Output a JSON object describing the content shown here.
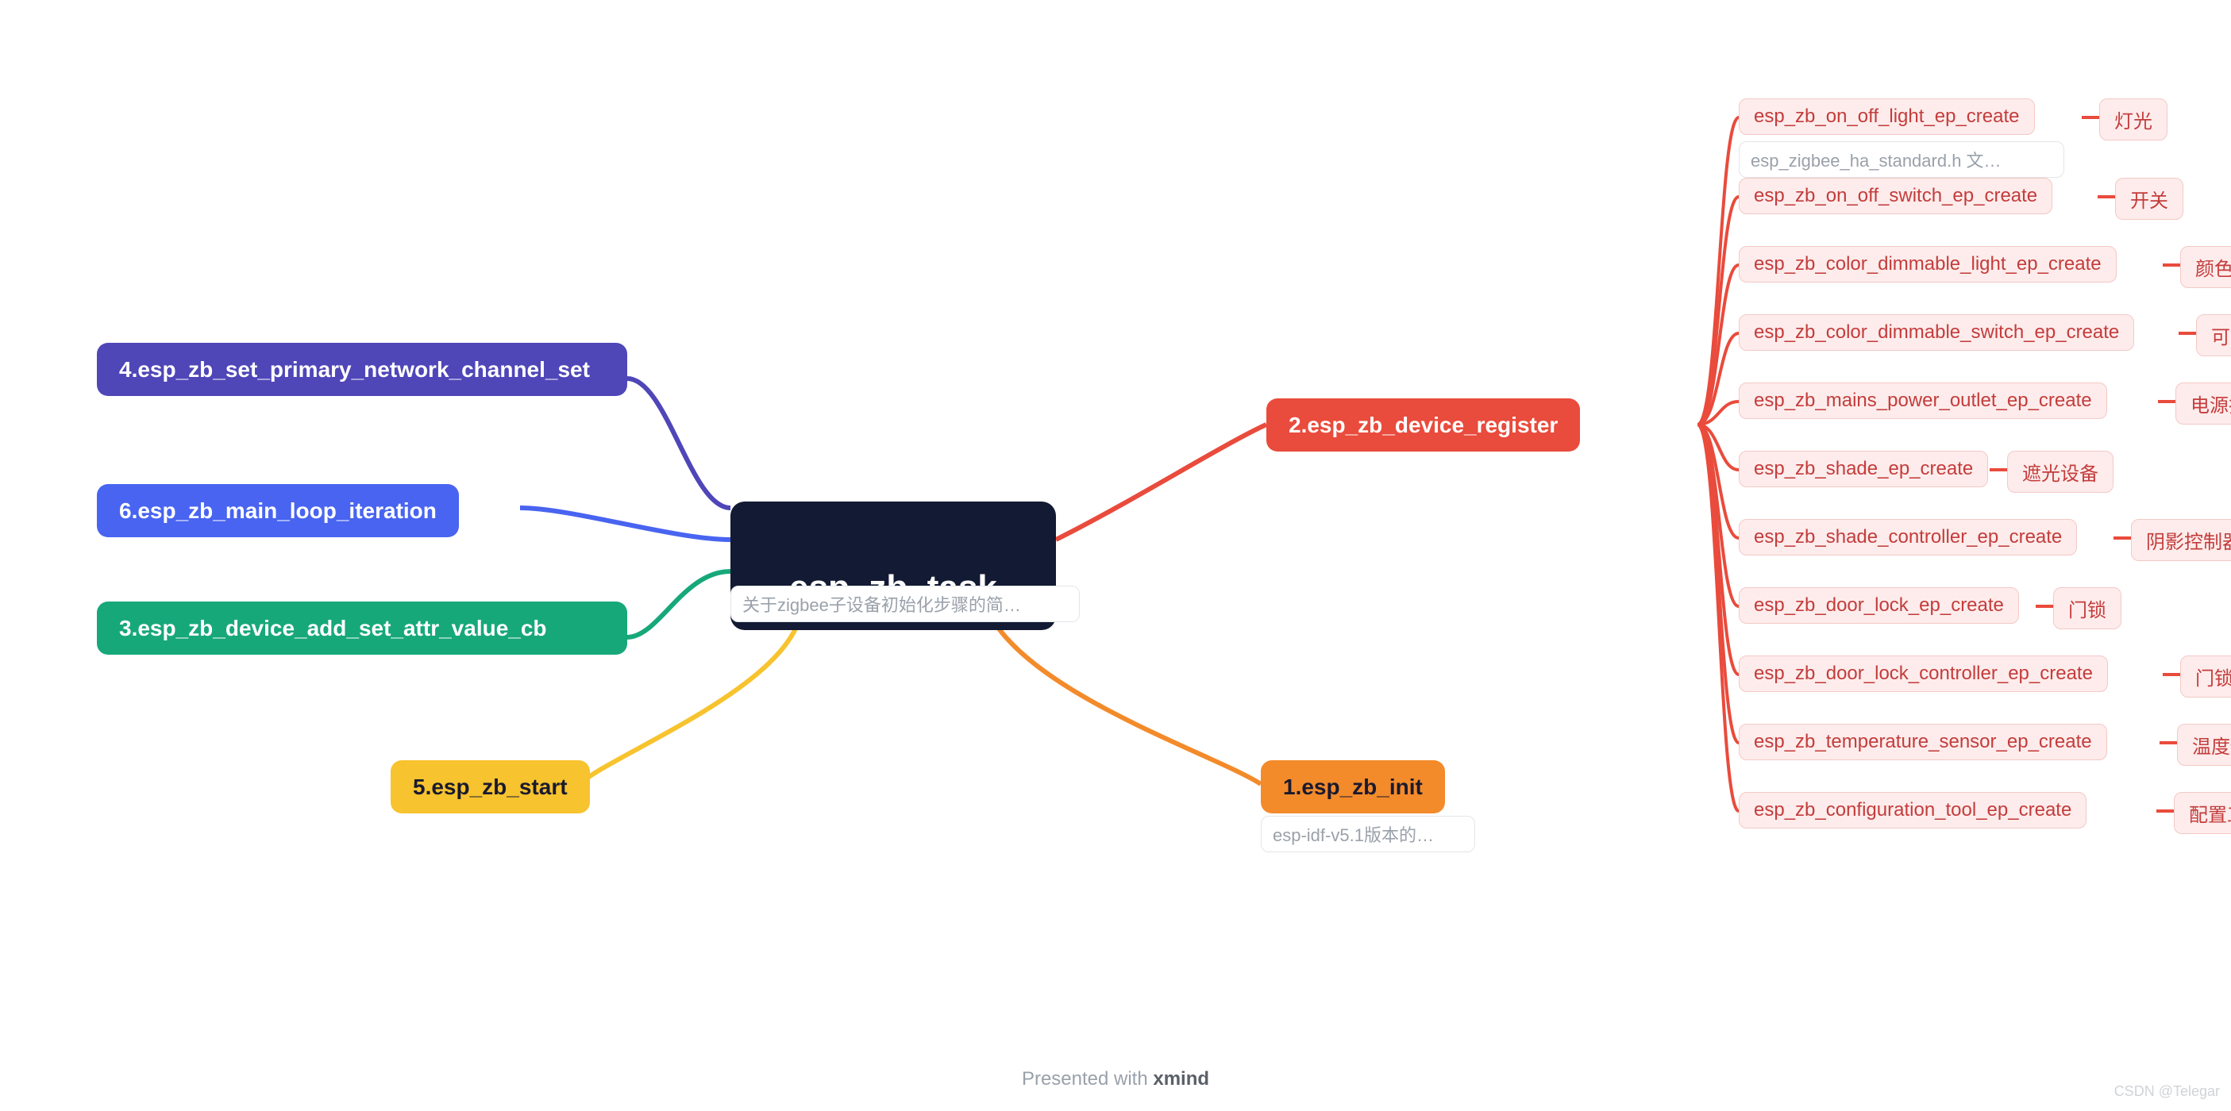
{
  "center": {
    "title": "esp_zb_task",
    "note": "关于zigbee子设备初始化步骤的简…"
  },
  "left": {
    "n4": {
      "label": "4.esp_zb_set_primary_network_channel_set"
    },
    "n6": {
      "label": "6.esp_zb_main_loop_iteration"
    },
    "n3": {
      "label": "3.esp_zb_device_add_set_attr_value_cb"
    },
    "n5": {
      "label": "5.esp_zb_start"
    }
  },
  "right": {
    "n2": {
      "label": "2.esp_zb_device_register"
    },
    "n1": {
      "label": "1.esp_zb_init",
      "note": "esp-idf-v5.1版本的…"
    }
  },
  "register_note": "esp_zigbee_ha_standard.h 文…",
  "devices": [
    {
      "fn": "esp_zb_on_off_light_ep_create",
      "desc": "灯光"
    },
    {
      "fn": "esp_zb_on_off_switch_ep_create",
      "desc": "开关"
    },
    {
      "fn": "esp_zb_color_dimmable_light_ep_create",
      "desc": "颜色可调光"
    },
    {
      "fn": "esp_zb_color_dimmable_switch_ep_create",
      "desc": "可调开关"
    },
    {
      "fn": "esp_zb_mains_power_outlet_ep_create",
      "desc": "电源插座"
    },
    {
      "fn": "esp_zb_shade_ep_create",
      "desc": "遮光设备"
    },
    {
      "fn": "esp_zb_shade_controller_ep_create",
      "desc": "阴影控制器"
    },
    {
      "fn": "esp_zb_door_lock_ep_create",
      "desc": "门锁"
    },
    {
      "fn": "esp_zb_door_lock_controller_ep_create",
      "desc": "门锁控制器"
    },
    {
      "fn": "esp_zb_temperature_sensor_ep_create",
      "desc": "温度传感器"
    },
    {
      "fn": "esp_zb_configuration_tool_ep_create",
      "desc": "配置工具"
    }
  ],
  "footer": {
    "prefix": "Presented with ",
    "brand": "xmind"
  },
  "watermark": "CSDN @Telegar",
  "layout": {
    "fn_widths": [
      432,
      452,
      534,
      554,
      528,
      316,
      472,
      374,
      534,
      530,
      526
    ],
    "desc_x": [
      2644,
      2664,
      2746,
      2766,
      2740,
      2528,
      2684,
      2586,
      2746,
      2742,
      2738
    ]
  }
}
